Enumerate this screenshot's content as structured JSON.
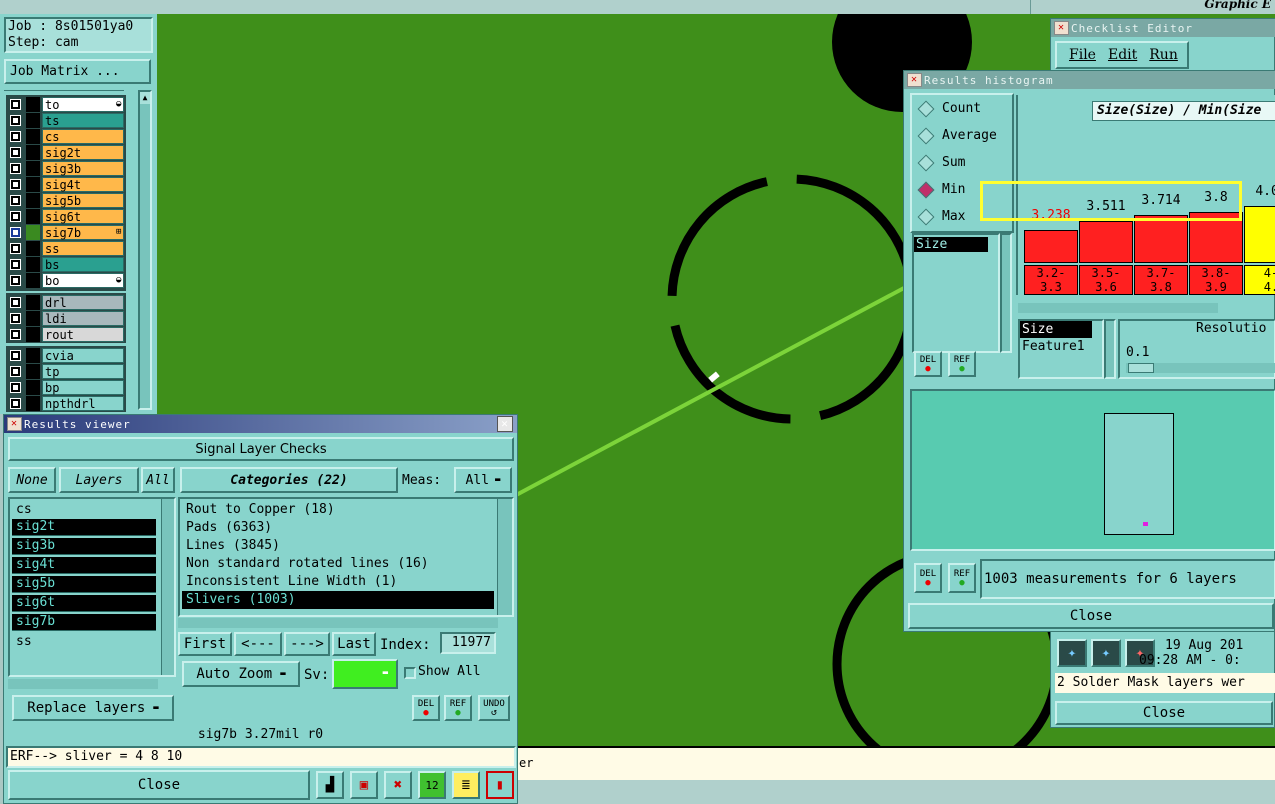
{
  "top": {
    "graphic_label": "Graphic E"
  },
  "job": {
    "job_label": "Job : 8s01501ya0",
    "step_label": "Step: cam",
    "matrix_button": "Job Matrix ..."
  },
  "layers": {
    "group1": [
      {
        "name": "to",
        "color": "#ffffff",
        "mark": "◒"
      },
      {
        "name": "ts",
        "color": "#2aa090",
        "mark": ""
      },
      {
        "name": "cs",
        "color": "#ffb84a",
        "mark": ""
      },
      {
        "name": "sig2t",
        "color": "#ffb84a",
        "mark": ""
      },
      {
        "name": "sig3b",
        "color": "#ffb84a",
        "mark": ""
      },
      {
        "name": "sig4t",
        "color": "#ffb84a",
        "mark": ""
      },
      {
        "name": "sig5b",
        "color": "#ffb84a",
        "mark": ""
      },
      {
        "name": "sig6t",
        "color": "#ffb84a",
        "mark": ""
      },
      {
        "name": "sig7b",
        "color": "#ffb84a",
        "mark": "⊞"
      },
      {
        "name": "ss",
        "color": "#ffb84a",
        "mark": ""
      },
      {
        "name": "bs",
        "color": "#2aa090",
        "mark": ""
      },
      {
        "name": "bo",
        "color": "#ffffff",
        "mark": "◒"
      }
    ],
    "group2": [
      {
        "name": "drl",
        "color": "#a8b8bc"
      },
      {
        "name": "ldi",
        "color": "#a8b8bc"
      },
      {
        "name": "rout",
        "color": "#d8d8d8"
      }
    ],
    "group3": [
      {
        "name": "cvia",
        "color": "#88d4cc"
      },
      {
        "name": "tp",
        "color": "#88d4cc"
      },
      {
        "name": "bp",
        "color": "#88d4cc"
      },
      {
        "name": "npthdrl",
        "color": "#88d4cc"
      }
    ]
  },
  "results_viewer": {
    "title": "Results viewer",
    "header": "Signal Layer Checks",
    "none_btn": "None",
    "layers_btn": "Layers",
    "all_btn": "All",
    "categories_btn": "Categories (22)",
    "meas_label": "Meas:",
    "meas_value": "All",
    "layer_list": [
      "cs",
      "sig2t",
      "sig3b",
      "sig4t",
      "sig5b",
      "sig6t",
      "sig7b",
      "ss"
    ],
    "layer_selected": [
      false,
      true,
      true,
      true,
      true,
      true,
      true,
      false
    ],
    "categories": [
      "Rout to Copper (18)",
      "Pads (6363)",
      "Lines (3845)",
      "Non standard rotated lines (16)",
      "Inconsistent Line Width (1)",
      "Slivers (1003)"
    ],
    "first_btn": "First",
    "prev_btn": "<---",
    "next_btn": "--->",
    "last_btn": "Last",
    "index_label": "Index:",
    "index_value": "11977",
    "auto_zoom": "Auto Zoom",
    "sv_label": "Sv:",
    "show_all": "Show All",
    "replace_layers": "Replace layers",
    "del_btn": "DEL",
    "ref_btn": "REF",
    "undo_btn": "UNDO",
    "status": "sig7b 3.27mil  r0",
    "erf": "ERF--> sliver = 4 8 10",
    "close": "Close"
  },
  "bottom_bar": {
    "text": "er"
  },
  "checklist": {
    "title": "Checklist Editor",
    "menu": [
      "File",
      "Edit",
      "Run"
    ],
    "date": "19 Aug 201",
    "time": "09:28 AM - 0:",
    "message": "2 Solder Mask layers wer",
    "close": "Close"
  },
  "histogram": {
    "title": "Results histogram",
    "options": [
      "Count",
      "Average",
      "Sum",
      "Min",
      "Max"
    ],
    "selected_option": "Min",
    "list_item": "Size",
    "chart_title": "Size(Size) / Min(Size",
    "bars": [
      {
        "value": "3.238",
        "range": "3.2-\n3.3",
        "color": "#ff2020"
      },
      {
        "value": "3.511",
        "range": "3.5-\n3.6",
        "color": "#ff2020"
      },
      {
        "value": "3.714",
        "range": "3.7-\n3.8",
        "color": "#ff2020"
      },
      {
        "value": "3.8",
        "range": "3.8-\n3.9",
        "color": "#ff2020"
      },
      {
        "value": "4.00",
        "range": "4-\n4.",
        "color": "#ffff00"
      }
    ],
    "bar_levels": [
      0.55,
      0.7,
      0.8,
      0.85,
      0.95
    ],
    "field_list": [
      "Size",
      "Feature1"
    ],
    "resolution_label": "Resolutio",
    "resolution_value": "0.1",
    "del_btn": "DEL",
    "ref_btn": "REF",
    "measurements": "1003 measurements for 6 layers",
    "close": "Close"
  }
}
